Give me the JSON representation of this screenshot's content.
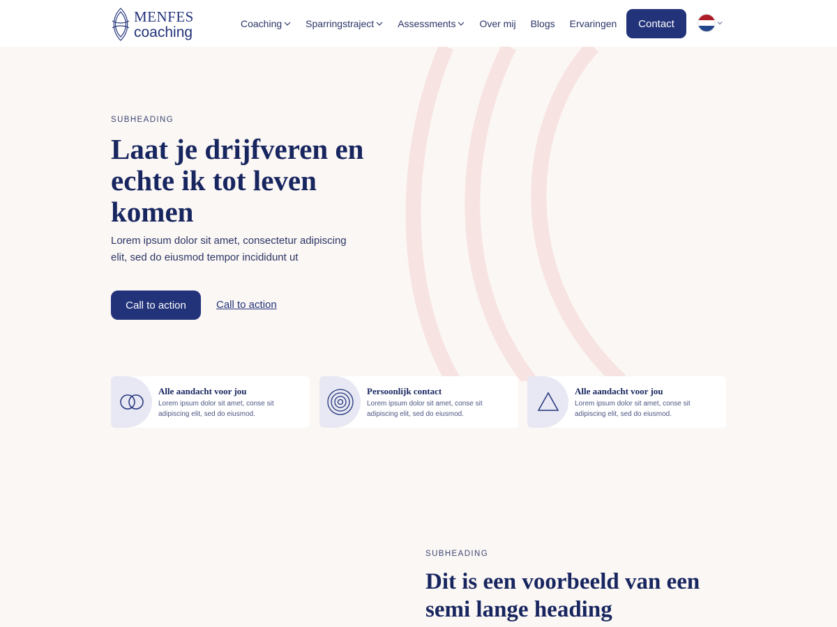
{
  "brand": {
    "line1": "MENFES",
    "line2": "coaching"
  },
  "nav": {
    "items": [
      {
        "label": "Coaching",
        "dropdown": true
      },
      {
        "label": "Sparringstraject",
        "dropdown": true
      },
      {
        "label": "Assessments",
        "dropdown": true
      },
      {
        "label": "Over mij",
        "dropdown": false
      },
      {
        "label": "Blogs",
        "dropdown": false
      },
      {
        "label": "Ervaringen",
        "dropdown": false
      }
    ],
    "contact_label": "Contact",
    "language_icon": "netherlands-flag-icon"
  },
  "hero": {
    "subheading": "SUBHEADING",
    "title": "Laat je drijfveren en echte ik tot leven komen",
    "body": "Lorem ipsum dolor sit amet, consectetur adipiscing elit, sed do eiusmod tempor incididunt ut",
    "cta_primary": "Call to action",
    "cta_secondary": "Call to action"
  },
  "features": [
    {
      "icon": "interlocking-circles-icon",
      "title": "Alle aandacht voor jou",
      "text": "Lorem ipsum dolor sit amet, conse sit adipiscing elit, sed do eiusmod."
    },
    {
      "icon": "target-circles-icon",
      "title": "Persoonlijk contact",
      "text": "Lorem ipsum dolor sit amet, conse sit adipiscing elit, sed do eiusmod."
    },
    {
      "icon": "triangle-icon",
      "title": "Alle aandacht voor jou",
      "text": "Lorem ipsum dolor sit amet, conse sit adipiscing elit, sed do eiusmod."
    }
  ],
  "section2": {
    "subheading": "SUBHEADING",
    "title": "Dit is een voorbeeld van een semi lange heading"
  },
  "colors": {
    "primary": "#22337a",
    "heading": "#182660",
    "background": "#fbf7f4",
    "icon_bg": "#e7e8f3",
    "arc": "#f7e4e2"
  }
}
